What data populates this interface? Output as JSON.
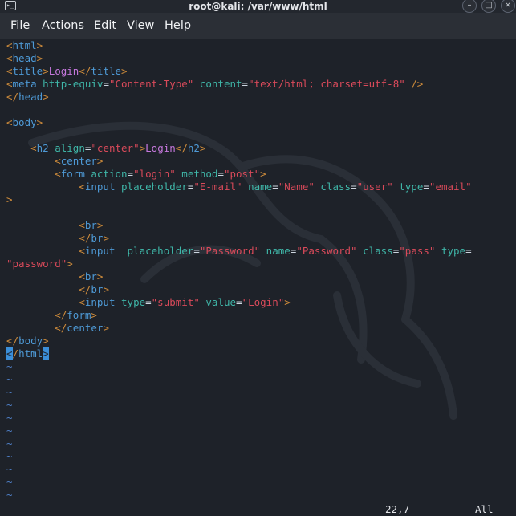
{
  "window": {
    "title": "root@kali: /var/www/html",
    "terminal_icon": "terminal-icon",
    "controls": [
      "minimize-icon",
      "maximize-icon",
      "close-icon"
    ]
  },
  "menu": {
    "items": [
      "File",
      "Actions",
      "Edit",
      "View",
      "Help"
    ]
  },
  "code_lines": [
    [
      [
        "tg",
        "<"
      ],
      [
        "tn",
        "html"
      ],
      [
        "tg",
        ">"
      ]
    ],
    [
      [
        "tg",
        "<"
      ],
      [
        "tn",
        "head"
      ],
      [
        "tg",
        ">"
      ]
    ],
    [
      [
        "tg",
        "<"
      ],
      [
        "tn",
        "title"
      ],
      [
        "tg",
        ">"
      ],
      [
        "tx",
        "Login"
      ],
      [
        "tg",
        "</"
      ],
      [
        "tn",
        "title"
      ],
      [
        "tg",
        ">"
      ]
    ],
    [
      [
        "tg",
        "<"
      ],
      [
        "tn",
        "meta"
      ],
      [
        "pl",
        " "
      ],
      [
        "at",
        "http-equiv"
      ],
      [
        "pl",
        "="
      ],
      [
        "st",
        "\"Content-Type\""
      ],
      [
        "pl",
        " "
      ],
      [
        "at",
        "content"
      ],
      [
        "pl",
        "="
      ],
      [
        "st",
        "\"text/html; charset=utf-8\""
      ],
      [
        "pl",
        " "
      ],
      [
        "tg",
        "/>"
      ]
    ],
    [
      [
        "tg",
        "</"
      ],
      [
        "tn",
        "head"
      ],
      [
        "tg",
        ">"
      ]
    ],
    [],
    [
      [
        "tg",
        "<"
      ],
      [
        "tn",
        "body"
      ],
      [
        "tg",
        ">"
      ]
    ],
    [],
    [
      [
        "pl",
        "    "
      ],
      [
        "tg",
        "<"
      ],
      [
        "tn",
        "h2"
      ],
      [
        "pl",
        " "
      ],
      [
        "at",
        "align"
      ],
      [
        "pl",
        "="
      ],
      [
        "st",
        "\"center\""
      ],
      [
        "tg",
        ">"
      ],
      [
        "tx",
        "Login"
      ],
      [
        "tg",
        "</"
      ],
      [
        "tn",
        "h2"
      ],
      [
        "tg",
        ">"
      ]
    ],
    [
      [
        "pl",
        "        "
      ],
      [
        "tg",
        "<"
      ],
      [
        "tn",
        "center"
      ],
      [
        "tg",
        ">"
      ]
    ],
    [
      [
        "pl",
        "        "
      ],
      [
        "tg",
        "<"
      ],
      [
        "tn",
        "form"
      ],
      [
        "pl",
        " "
      ],
      [
        "at",
        "action"
      ],
      [
        "pl",
        "="
      ],
      [
        "st",
        "\"login\""
      ],
      [
        "pl",
        " "
      ],
      [
        "at",
        "method"
      ],
      [
        "pl",
        "="
      ],
      [
        "st",
        "\"post\""
      ],
      [
        "tg",
        ">"
      ]
    ],
    [
      [
        "pl",
        "            "
      ],
      [
        "tg",
        "<"
      ],
      [
        "tn",
        "input"
      ],
      [
        "pl",
        " "
      ],
      [
        "at",
        "placeholder"
      ],
      [
        "pl",
        "="
      ],
      [
        "st",
        "\"E-mail\""
      ],
      [
        "pl",
        " "
      ],
      [
        "at",
        "name"
      ],
      [
        "pl",
        "="
      ],
      [
        "st",
        "\"Name\""
      ],
      [
        "pl",
        " "
      ],
      [
        "at",
        "class"
      ],
      [
        "pl",
        "="
      ],
      [
        "st",
        "\"user\""
      ],
      [
        "pl",
        " "
      ],
      [
        "at",
        "type"
      ],
      [
        "pl",
        "="
      ],
      [
        "st",
        "\"email\""
      ]
    ],
    [
      [
        "tg",
        ">"
      ]
    ],
    [],
    [
      [
        "pl",
        "            "
      ],
      [
        "tg",
        "<"
      ],
      [
        "tn",
        "br"
      ],
      [
        "tg",
        ">"
      ]
    ],
    [
      [
        "pl",
        "            "
      ],
      [
        "tg",
        "</"
      ],
      [
        "tn",
        "br"
      ],
      [
        "tg",
        ">"
      ]
    ],
    [
      [
        "pl",
        "            "
      ],
      [
        "tg",
        "<"
      ],
      [
        "tn",
        "input"
      ],
      [
        "pl",
        "  "
      ],
      [
        "at",
        "placeholder"
      ],
      [
        "pl",
        "="
      ],
      [
        "st",
        "\"Password\""
      ],
      [
        "pl",
        " "
      ],
      [
        "at",
        "name"
      ],
      [
        "pl",
        "="
      ],
      [
        "st",
        "\"Password\""
      ],
      [
        "pl",
        " "
      ],
      [
        "at",
        "class"
      ],
      [
        "pl",
        "="
      ],
      [
        "st",
        "\"pass\""
      ],
      [
        "pl",
        " "
      ],
      [
        "at",
        "type"
      ],
      [
        "pl",
        "="
      ]
    ],
    [
      [
        "st",
        "\"password\""
      ],
      [
        "tg",
        ">"
      ]
    ],
    [
      [
        "pl",
        "            "
      ],
      [
        "tg",
        "<"
      ],
      [
        "tn",
        "br"
      ],
      [
        "tg",
        ">"
      ]
    ],
    [
      [
        "pl",
        "            "
      ],
      [
        "tg",
        "</"
      ],
      [
        "tn",
        "br"
      ],
      [
        "tg",
        ">"
      ]
    ],
    [
      [
        "pl",
        "            "
      ],
      [
        "tg",
        "<"
      ],
      [
        "tn",
        "input"
      ],
      [
        "pl",
        " "
      ],
      [
        "at",
        "type"
      ],
      [
        "pl",
        "="
      ],
      [
        "st",
        "\"submit\""
      ],
      [
        "pl",
        " "
      ],
      [
        "at",
        "value"
      ],
      [
        "pl",
        "="
      ],
      [
        "st",
        "\"Login\""
      ],
      [
        "tg",
        ">"
      ]
    ],
    [
      [
        "pl",
        "        "
      ],
      [
        "tg",
        "</"
      ],
      [
        "tn",
        "form"
      ],
      [
        "tg",
        ">"
      ]
    ],
    [
      [
        "pl",
        "        "
      ],
      [
        "tg",
        "</"
      ],
      [
        "tn",
        "center"
      ],
      [
        "tg",
        ">"
      ]
    ],
    [
      [
        "tg",
        "</"
      ],
      [
        "tn",
        "body"
      ],
      [
        "tg",
        ">"
      ]
    ],
    [
      [
        "cursor",
        "<"
      ],
      [
        "tg",
        "/"
      ],
      [
        "tn",
        "html"
      ],
      [
        "cursor",
        ">"
      ]
    ],
    [
      [
        "tilde",
        "~"
      ]
    ],
    [
      [
        "tilde",
        "~"
      ]
    ],
    [
      [
        "tilde",
        "~"
      ]
    ],
    [
      [
        "tilde",
        "~"
      ]
    ],
    [
      [
        "tilde",
        "~"
      ]
    ],
    [
      [
        "tilde",
        "~"
      ]
    ],
    [
      [
        "tilde",
        "~"
      ]
    ],
    [
      [
        "tilde",
        "~"
      ]
    ],
    [
      [
        "tilde",
        "~"
      ]
    ],
    [
      [
        "tilde",
        "~"
      ]
    ],
    [
      [
        "tilde",
        "~"
      ]
    ],
    [
      [
        "tilde",
        "~"
      ]
    ]
  ],
  "status": {
    "position": "22,7",
    "scroll": "All"
  },
  "colors": {
    "background": "#1e2229",
    "tag_bracket": "#cf8c3b",
    "tag_name": "#4e9ad6",
    "attribute": "#3fb6a8",
    "string": "#d94a5a",
    "text": "#c678dd",
    "tilde": "#4e7fc7",
    "cursor": "#3b8fd9"
  }
}
